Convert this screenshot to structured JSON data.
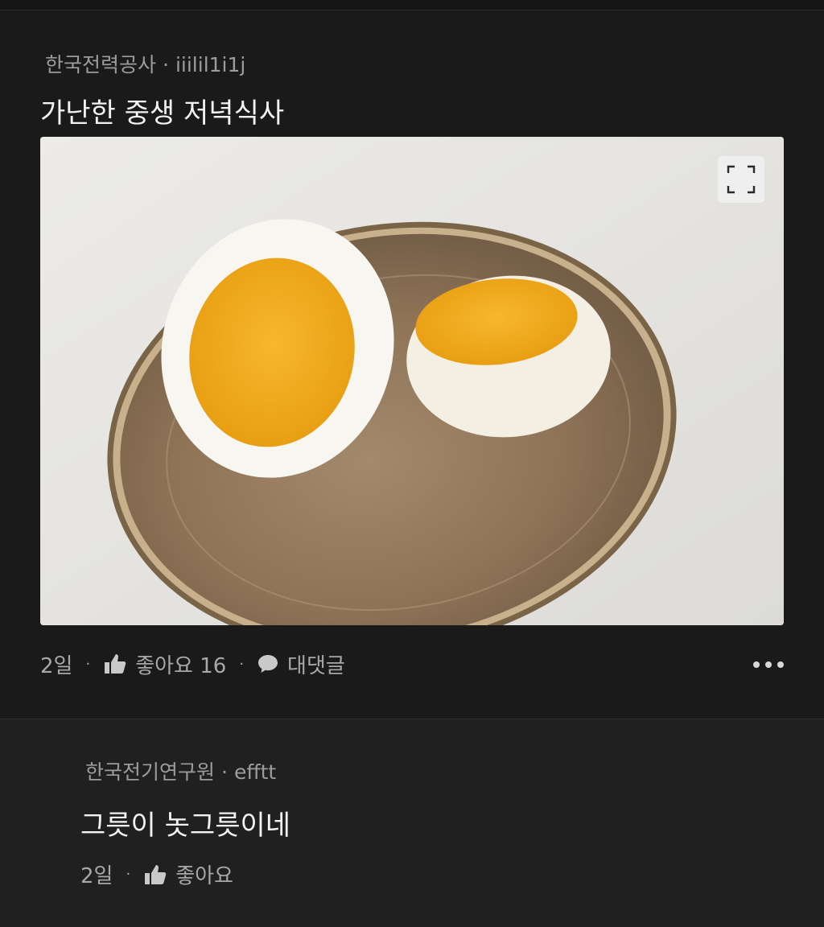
{
  "post": {
    "author_group": "한국전력공사",
    "author_name": "iiilil1i1j",
    "title": "가난한 중생 저녁식사",
    "time": "2일",
    "like_label": "좋아요 16",
    "comment_label": "대댓글"
  },
  "comment": {
    "author_group": "한국전기연구원",
    "author_name": "efftt",
    "text": "그릇이 놋그릇이네",
    "time": "2일",
    "like_label": "좋아요"
  },
  "icons": {
    "expand": "expand-icon",
    "like": "thumbs-up-icon",
    "comment": "speech-bubble-icon",
    "more": "more-icon"
  },
  "colors": {
    "background": "#1a1a1a",
    "comment_background": "#202020",
    "text_primary": "#f2f2f2",
    "text_secondary": "#9c9c9c"
  }
}
